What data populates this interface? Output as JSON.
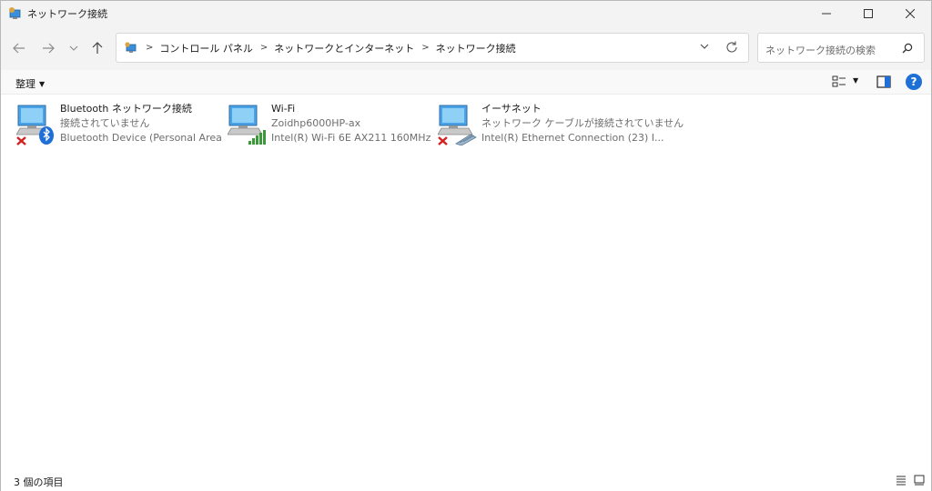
{
  "window": {
    "title": "ネットワーク接続",
    "controls": [
      "minimize",
      "maximize",
      "close"
    ]
  },
  "address_bar": {
    "breadcrumbs": [
      "コントロール パネル",
      "ネットワークとインターネット",
      "ネットワーク接続"
    ]
  },
  "search": {
    "placeholder": "ネットワーク接続の検索"
  },
  "toolbar": {
    "organize_label": "整理"
  },
  "connections": [
    {
      "name": "Bluetooth ネットワーク接続",
      "status": "接続されていません",
      "device": "Bluetooth Device (Personal Area ...",
      "state": "disconnected",
      "badge_icon": "bluetooth-icon"
    },
    {
      "name": "Wi-Fi",
      "status": "Zoidhp6000HP-ax",
      "device": "Intel(R) Wi-Fi 6E AX211 160MHz",
      "state": "connected",
      "badge_icon": "wifi-signal-icon"
    },
    {
      "name": "イーサネット",
      "status": "ネットワーク ケーブルが接続されていません",
      "device": "Intel(R) Ethernet Connection (23) I...",
      "state": "disconnected",
      "badge_icon": "ethernet-cable-icon"
    }
  ],
  "statusbar": {
    "item_count": "3 個の項目"
  },
  "colors": {
    "accent": "#1e6fd6",
    "error": "#d42020",
    "signal": "#3a9a3a"
  }
}
